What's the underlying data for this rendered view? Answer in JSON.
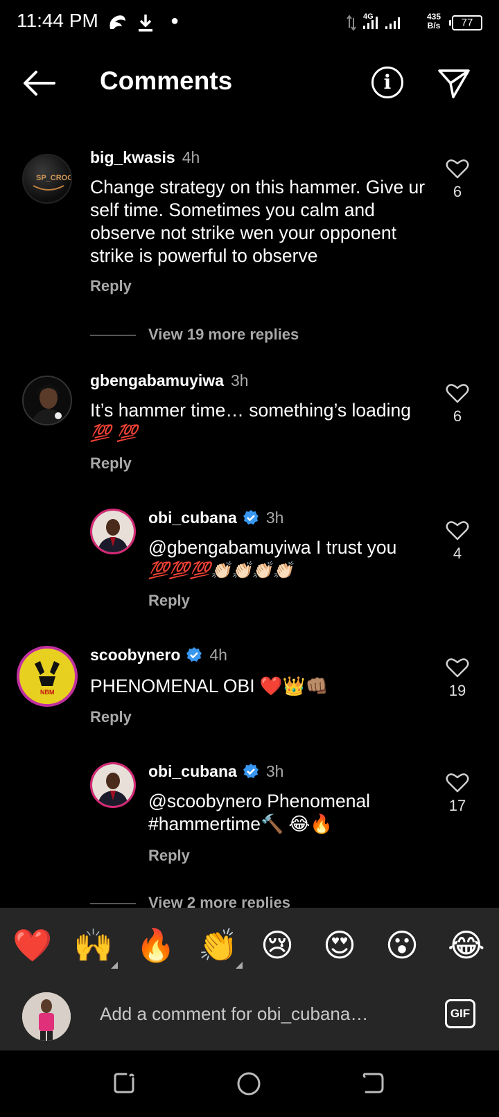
{
  "status_bar": {
    "time": "11:44 PM",
    "network": "4G",
    "net_speed_value": "435",
    "net_speed_unit": "B/s",
    "battery": "77"
  },
  "header": {
    "title": "Comments",
    "back_icon": "back-arrow-icon",
    "info_icon": "info-icon",
    "share_icon": "send-icon"
  },
  "comments": [
    {
      "username": "big_kwasis",
      "time": "4h",
      "text": "Change strategy on this hammer. Give ur self time. Sometimes you calm and observe not strike wen your opponent strike is powerful to observe",
      "likes": "6",
      "reply_label": "Reply",
      "view_more": "View 19 more replies"
    },
    {
      "username": "gbengabamuyiwa",
      "time": "3h",
      "text": "It’s hammer time… something’s loading",
      "emoji": "💯 💯",
      "likes": "6",
      "reply_label": "Reply"
    },
    {
      "username": "obi_cubana",
      "verified": true,
      "time": "3h",
      "text": "@gbengabamuyiwa I trust you",
      "emoji": "💯💯💯👏🏻👏🏻👏🏻👏🏻",
      "likes": "4",
      "reply_label": "Reply"
    },
    {
      "username": "scoobynero",
      "verified": true,
      "time": "4h",
      "text": "PHENOMENAL OBI ❤️👑👊🏽",
      "likes": "19",
      "reply_label": "Reply"
    },
    {
      "username": "obi_cubana",
      "verified": true,
      "time": "3h",
      "text_line1": "@scoobynero Phenomenal",
      "text_line2": "#hammertime🔨 😂🔥",
      "likes": "17",
      "reply_label": "Reply",
      "view_more": "View 2 more replies"
    }
  ],
  "emoji_bar": [
    "❤️",
    "🙌",
    "🔥",
    "👏",
    "😢",
    "😍",
    "😮",
    "😂"
  ],
  "comment_input": {
    "placeholder": "Add a comment for obi_cubana…",
    "gif_label": "GIF"
  },
  "colors": {
    "background": "#000000",
    "secondary_text": "#a8a8a8",
    "verified_blue": "#3897f0",
    "input_bar": "#262626"
  }
}
